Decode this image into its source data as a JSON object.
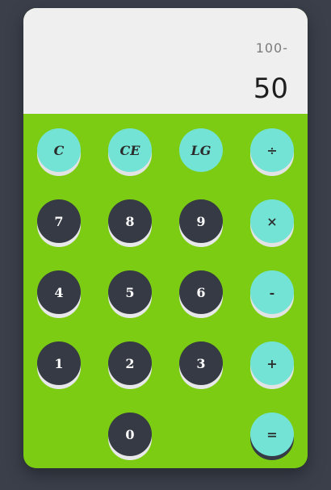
{
  "display": {
    "expression": "100-",
    "result": "50"
  },
  "keys": {
    "clear": "C",
    "clear_entry": "CE",
    "backspace": "LG",
    "divide": "÷",
    "seven": "7",
    "eight": "8",
    "nine": "9",
    "multiply": "×",
    "four": "4",
    "five": "5",
    "six": "6",
    "subtract": "-",
    "one": "1",
    "two": "2",
    "three": "3",
    "add": "+",
    "zero": "0",
    "equals": "="
  },
  "colors": {
    "background": "#3a3f4a",
    "keypad": "#7ccc14",
    "display": "#efefef",
    "accent_key": "#72e3d5",
    "number_key": "#353a44"
  }
}
